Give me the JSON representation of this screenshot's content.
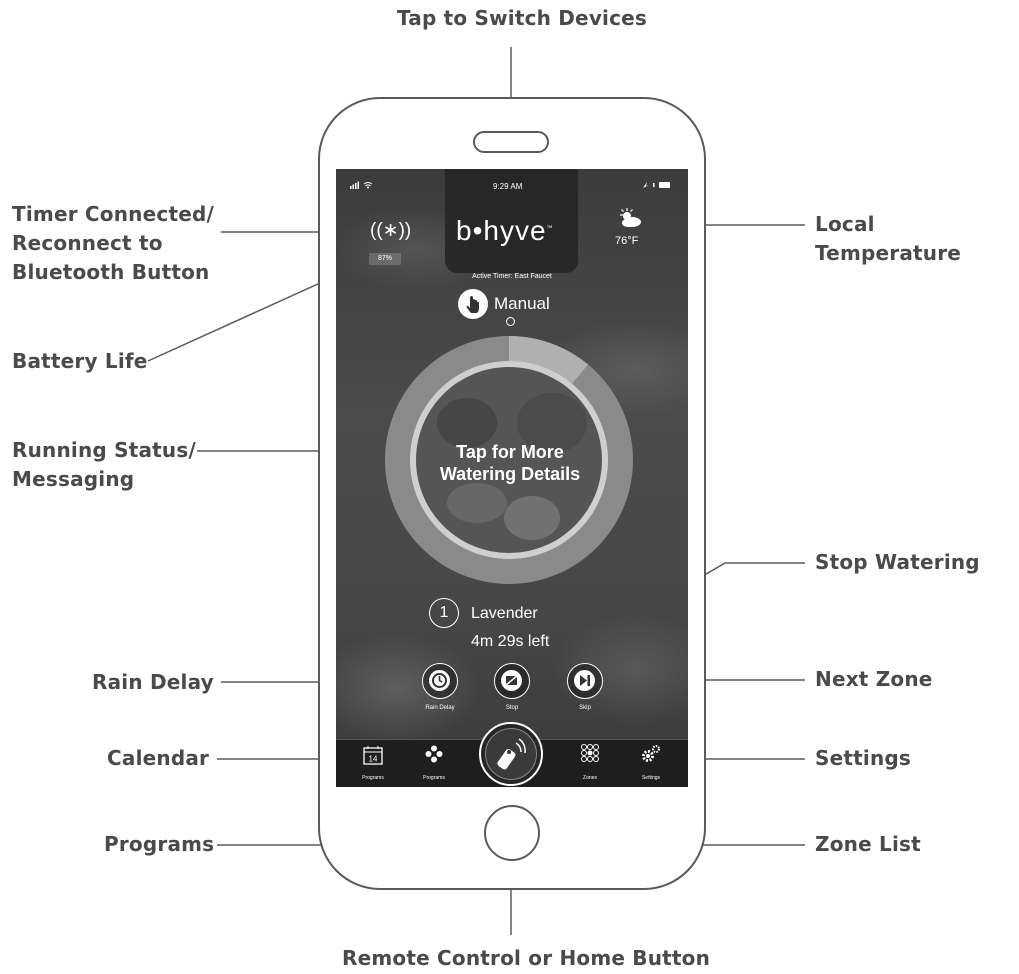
{
  "callouts": {
    "tap_switch": "Tap to Switch Devices",
    "timer_line1": "Timer Connected/",
    "timer_line2": "Reconnect to",
    "timer_line3": "Bluetooth Button",
    "local_temp": "Local Temperature",
    "battery_life": "Battery Life",
    "running_line1": "Running Status/",
    "running_line2": "Messaging",
    "stop_watering": "Stop Watering",
    "rain_delay": "Rain Delay",
    "next_zone": "Next Zone",
    "calendar": "Calendar",
    "settings": "Settings",
    "programs": "Programs",
    "zone_list": "Zone List",
    "remote": "Remote Control or Home Button"
  },
  "screen": {
    "status": {
      "time": "9:29 AM"
    },
    "logo": "b•hyve",
    "bluetooth_icon": "((∗))",
    "battery": "87%",
    "weather_icon": "partly-cloudy-icon",
    "temperature": "76°F",
    "active_timer": "Active Timer: East Faucet",
    "mode": "Manual",
    "ring": {
      "line1": "Tap for More",
      "line2": "Watering Details",
      "progress_fraction": 0.11
    },
    "zone": {
      "number": "1",
      "name": "Lavender",
      "remaining": "4m 29s left"
    },
    "controls": {
      "rain_delay": "Rain Delay",
      "stop": "Stop",
      "skip": "Skip"
    },
    "tabs": {
      "calendar_day": "14",
      "calendar": "Programs",
      "programs": "Programs",
      "zones": "Zones",
      "settings": "Settings"
    }
  },
  "colors": {
    "ring": "#8a8a8a",
    "ring_progress": "#b0b0b0",
    "label": "#4a4a4a",
    "outline": "#5a5a5a"
  }
}
